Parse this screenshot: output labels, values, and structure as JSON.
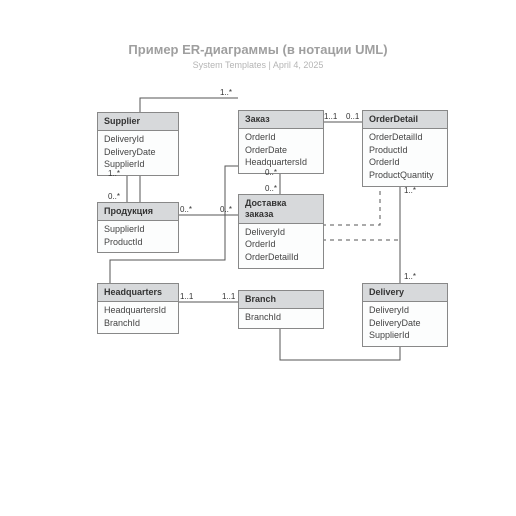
{
  "title": "Пример ER-диаграммы (в нотации UML)",
  "subtitle_author": "System Templates",
  "subtitle_sep": " | ",
  "subtitle_date": "April 4, 2025",
  "entities": {
    "supplier": {
      "name": "Supplier",
      "attrs": [
        "DeliveryId",
        "DeliveryDate",
        "SupplierId"
      ]
    },
    "product": {
      "name": "Продукция",
      "attrs": [
        "SupplierId",
        "ProductId"
      ]
    },
    "hq": {
      "name": "Headquarters",
      "attrs": [
        "HeadquartersId",
        "BranchId"
      ]
    },
    "order": {
      "name": "Заказ",
      "attrs": [
        "OrderId",
        "OrderDate",
        "HeadquartersId"
      ]
    },
    "orderDelivery": {
      "name": "Доставка заказа",
      "attrs": [
        "DeliveryId",
        "OrderId",
        "OrderDetailId"
      ]
    },
    "branch": {
      "name": "Branch",
      "attrs": [
        "BranchId"
      ]
    },
    "orderDetail": {
      "name": "OrderDetail",
      "attrs": [
        "OrderDetailId",
        "ProductId",
        "OrderId",
        "ProductQuantity"
      ]
    },
    "delivery": {
      "name": "Delivery",
      "attrs": [
        "DeliveryId",
        "DeliveryDate",
        "SupplierId"
      ]
    }
  },
  "multiplicities": {
    "supplier_product_top": "1..*",
    "supplier_product_bot": "0..*",
    "product_order_left": "0..*",
    "product_order_right": "0..*",
    "order_orderdetail_left": "1..1",
    "order_orderdetail_right": "0..1",
    "hq_branch_left": "1..1",
    "hq_branch_right": "1..1",
    "orderdetail_delivery_top": "1..*",
    "orderdetail_delivery_bot": "1..*",
    "product_orderdetail_right": "1..*",
    "order_orderdelivery_top": "0..*",
    "order_orderdelivery_bot": "0..*"
  }
}
